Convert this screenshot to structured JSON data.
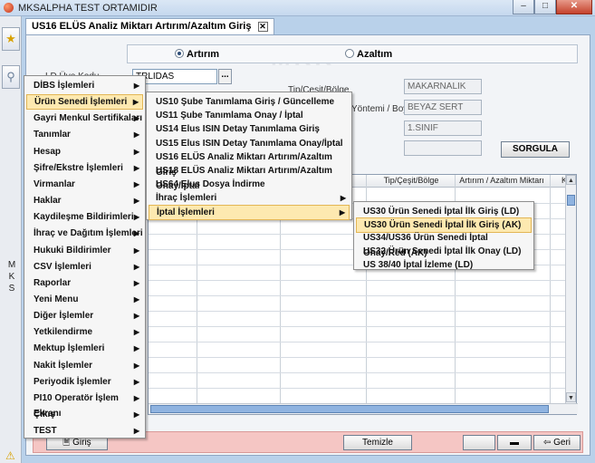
{
  "window": {
    "title": "MKSALPHA TEST ORTAMIDIR",
    "close_label": "✕",
    "min_label": "–",
    "max_label": "□"
  },
  "left_strip": {
    "vertical_label": "M\nK\nS"
  },
  "tab": {
    "label": "US16 ELÜS Analiz Miktarı Artırım/Azaltım Giriş",
    "close_label": "✕"
  },
  "watermark_text": "MKK",
  "form": {
    "radio_options": [
      {
        "label": "Artırım",
        "selected": true
      },
      {
        "label": "Azaltım",
        "selected": false
      }
    ],
    "ld_uye_kodu_label": "LD Üye Kodu",
    "ld_uye_kodu_value": "TRLIDAS",
    "ellipsis_label": "...",
    "tip_cesit_bolge_label": "Tip/Çeşit/Bölge",
    "tip_cesit_bolge_value": "MAKARNALIK",
    "yontemi_boy_label": "Yöntemi / Boy",
    "yontemi_boy_value": "BEYAZ SERT",
    "sinif_value": "1.SINIF",
    "empty_value": "",
    "sorgula_label": "SORGULA"
  },
  "grid": {
    "columns": [
      "Tip/Çeşit/Bölge",
      "Artırım / Azaltım Miktarı",
      "K"
    ]
  },
  "bottom_bar": {
    "giris_label": "Giriş",
    "temizle_label": "Temizle",
    "geri_label": "Geri"
  },
  "main_menu": {
    "items": [
      {
        "label": "DİBS İşlemleri"
      },
      {
        "label": "Ürün Senedi İşlemleri"
      },
      {
        "label": "Gayri Menkul Sertifikaları"
      },
      {
        "label": "Tanımlar"
      },
      {
        "label": "Hesap"
      },
      {
        "label": "Şifre/Ekstre İşlemleri"
      },
      {
        "label": "Virmanlar"
      },
      {
        "label": "Haklar"
      },
      {
        "label": "Kaydileşme Bildirimleri"
      },
      {
        "label": "İhraç ve Dağıtım İşlemleri"
      },
      {
        "label": "Hukuki Bildirimler"
      },
      {
        "label": "CSV İşlemleri"
      },
      {
        "label": "Raporlar"
      },
      {
        "label": "Yeni Menu"
      },
      {
        "label": "Diğer İşlemler"
      },
      {
        "label": "Yetkilendirme"
      },
      {
        "label": "Mektup İşlemleri"
      },
      {
        "label": "Nakit İşlemler"
      },
      {
        "label": "Periyodik İşlemler"
      },
      {
        "label": "PI10 Operatör  İşlem Ekranı"
      },
      {
        "label": "Çıkış"
      },
      {
        "label": "TEST"
      }
    ]
  },
  "submenu_urun_senedi": {
    "items": [
      {
        "label": "US10 Şube Tanımlama Giriş / Güncelleme"
      },
      {
        "label": "US11 Şube Tanımlama Onay / İptal"
      },
      {
        "label": "US14 Elus ISIN Detay Tanımlama Giriş"
      },
      {
        "label": "US15 Elus ISIN Detay Tanımlama Onay/İptal"
      },
      {
        "label": "US16 ELÜS Analiz Miktarı Artırım/Azaltım Giriş"
      },
      {
        "label": "US18 ELÜS Analiz Miktarı Artırım/Azaltım Onay/İptal"
      },
      {
        "label": "US64 Elus Dosya İndirme"
      },
      {
        "label": "İhraç İşlemleri"
      },
      {
        "label": "İptal İşlemleri"
      }
    ]
  },
  "submenu_iptal": {
    "items": [
      {
        "label": "US30 Ürün Senedi İptal İlk Giriş (LD)"
      },
      {
        "label": "US30 Ürün Senedi İptal İlk Giriş (AK)"
      },
      {
        "label": "US34/US36 Ürün Senedi İptal Onay/Red (AK)"
      },
      {
        "label": "US32 Ürün Senedi İptal İlk Onay (LD)"
      },
      {
        "label": "US 38/40 İptal İzleme (LD)"
      }
    ]
  }
}
